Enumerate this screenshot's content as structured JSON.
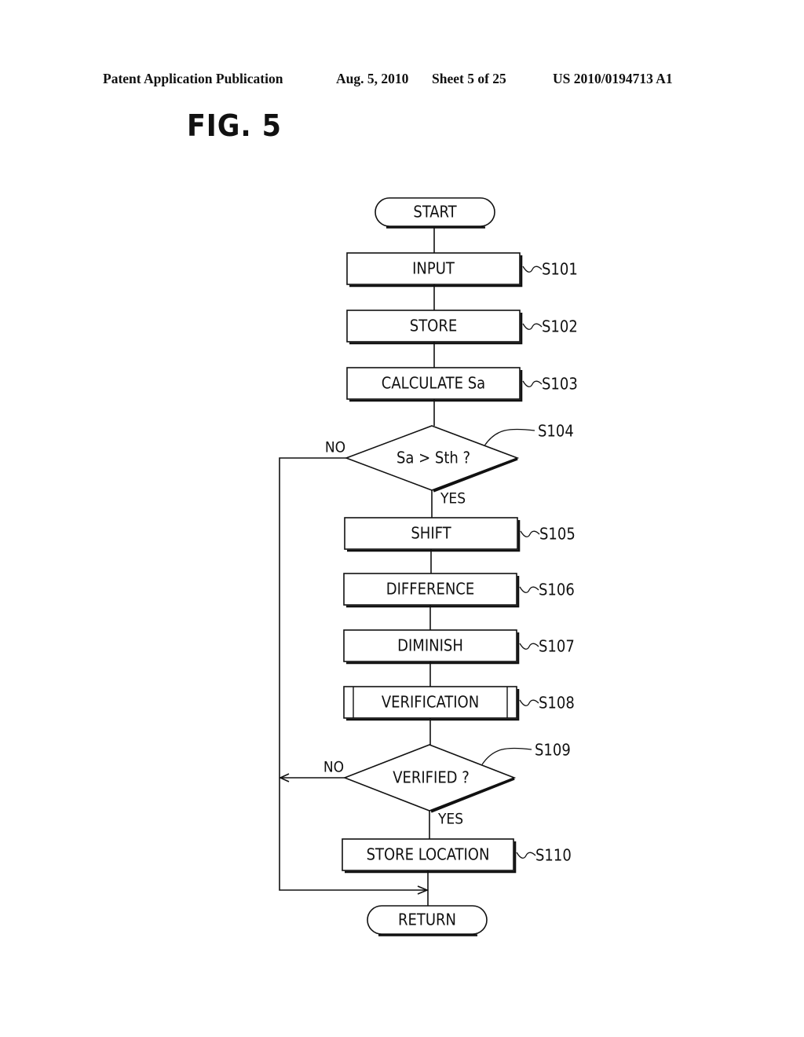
{
  "header": {
    "publication": "Patent Application Publication",
    "date": "Aug. 5, 2010",
    "sheet": "Sheet 5 of 25",
    "number": "US 2010/0194713 A1"
  },
  "figure": {
    "title": "FIG. 5"
  },
  "flowchart": {
    "start": "START",
    "end": "RETURN",
    "steps": [
      {
        "id": "S101",
        "type": "process",
        "label": "INPUT"
      },
      {
        "id": "S102",
        "type": "process",
        "label": "STORE"
      },
      {
        "id": "S103",
        "type": "process",
        "label": "CALCULATE Sa"
      },
      {
        "id": "S104",
        "type": "decision",
        "label": "Sa > Sth ?",
        "yes": "YES",
        "no": "NO"
      },
      {
        "id": "S105",
        "type": "process",
        "label": "SHIFT"
      },
      {
        "id": "S106",
        "type": "process",
        "label": "DIFFERENCE"
      },
      {
        "id": "S107",
        "type": "process",
        "label": "DIMINISH"
      },
      {
        "id": "S108",
        "type": "subroutine",
        "label": "VERIFICATION"
      },
      {
        "id": "S109",
        "type": "decision",
        "label": "VERIFIED ?",
        "yes": "YES",
        "no": "NO"
      },
      {
        "id": "S110",
        "type": "process",
        "label": "STORE LOCATION"
      }
    ]
  }
}
